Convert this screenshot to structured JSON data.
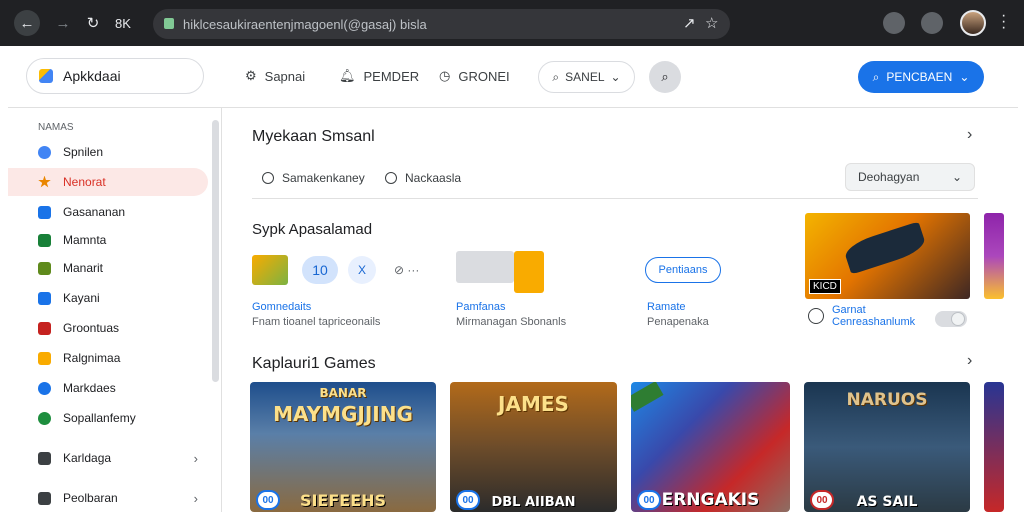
{
  "browser": {
    "url": "hiklcesaukiraentenjmagoenl(@gasaj) bisla",
    "back_icon": "arrow-left-icon",
    "forward_icon": "arrow-right-icon",
    "reload_icon": "reload-icon",
    "reader_label": "8K"
  },
  "topbar": {
    "brand": "Apkkdaai",
    "links": [
      "Sapnai",
      "PEMDER",
      "GRONEI"
    ],
    "filter_pill": "SANEL",
    "primary_button": "PENCBAEN"
  },
  "sidebar": {
    "heading": "NAMAS",
    "items": [
      {
        "label": "Spnilen",
        "color": "#4285f4"
      },
      {
        "label": "Nenorat",
        "color": "#ea8600"
      },
      {
        "label": "Gasananan",
        "color": "#1a73e8"
      },
      {
        "label": "Mamnta",
        "color": "#188038"
      },
      {
        "label": "Manarit",
        "color": "#5f8a1c"
      },
      {
        "label": "Kayani",
        "color": "#1a73e8"
      },
      {
        "label": "Groontuas",
        "color": "#c5221f"
      },
      {
        "label": "Ralgnimaa",
        "color": "#f9ab00"
      },
      {
        "label": "Markdaes",
        "color": "#1a73e8"
      },
      {
        "label": "Sopallanfemy",
        "color": "#1e8e3e"
      },
      {
        "label": "Karldaga",
        "color": "#3c4043"
      },
      {
        "label": "Peolbaran",
        "color": "#3c4043"
      }
    ]
  },
  "main": {
    "section1_title": "Myekaan Smsanl",
    "radio1": "Samakenkaney",
    "radio2": "Nackaasla",
    "sort_select": "Deohagyan",
    "section2_title": "Sypk Apasalamad",
    "badge_number": "10",
    "badge_x": "X",
    "card1_title": "Gomnedaits",
    "card1_sub": "Fnam tioanel tapriceonails",
    "card2_title": "Pamfanas",
    "card2_sub": "Mirmanagan Sbonanls",
    "card3_pill": "Pentiaans",
    "card3_title": "Ramate",
    "card3_sub": "Penapenaka",
    "card4_title": "Garnat",
    "card4_sub": "Cenreashanlumk",
    "card4_tag": "KICD",
    "section3_title": "Kaplauri1 Games",
    "games": [
      {
        "top": "BANAR",
        "title": "MAYMGJJING",
        "bottom": "SIEFEEHS",
        "badge": "00"
      },
      {
        "top": "",
        "title": "JAMES",
        "bottom": "DBL AIIBAN",
        "badge": "00"
      },
      {
        "top": "",
        "title": "",
        "bottom": "ERNGAKIS",
        "badge": "00"
      },
      {
        "top": "NARUOS",
        "title": "",
        "bottom": "AS SAIL",
        "badge": "00"
      }
    ]
  }
}
